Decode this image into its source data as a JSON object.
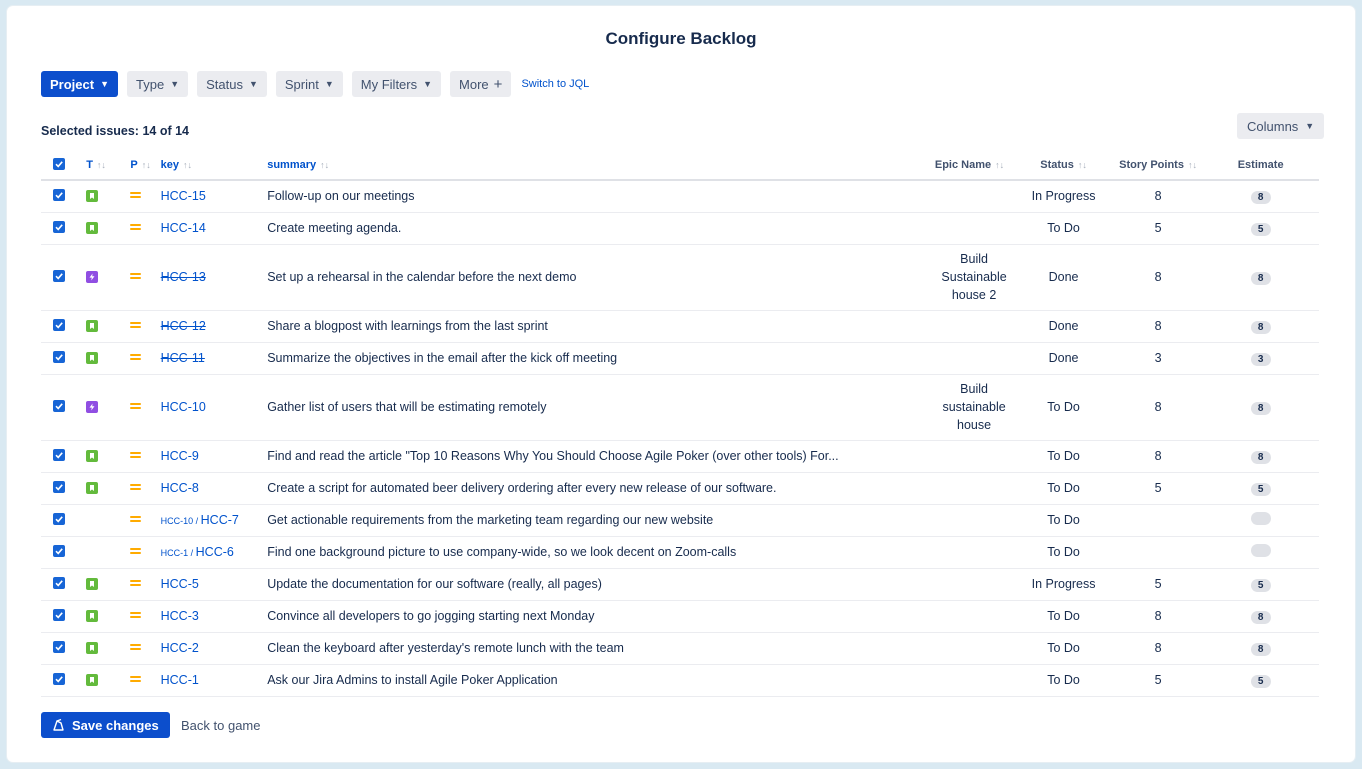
{
  "title": "Configure Backlog",
  "filters": [
    {
      "label": "Project",
      "primary": true,
      "icon": "chevron-down"
    },
    {
      "label": "Type",
      "primary": false,
      "icon": "chevron-down"
    },
    {
      "label": "Status",
      "primary": false,
      "icon": "chevron-down"
    },
    {
      "label": "Sprint",
      "primary": false,
      "icon": "chevron-down"
    },
    {
      "label": "My Filters",
      "primary": false,
      "icon": "chevron-down"
    },
    {
      "label": "More",
      "primary": false,
      "icon": "plus"
    }
  ],
  "switch_jql": "Switch to JQL",
  "selected_text": "Selected issues: 14 of 14",
  "columns_button": "Columns",
  "headers": {
    "t": "T",
    "p": "P",
    "key": "key",
    "summary": "summary",
    "epic": "Epic Name",
    "status": "Status",
    "story_points": "Story Points",
    "estimate": "Estimate"
  },
  "rows": [
    {
      "type": "story",
      "parent": "",
      "key": "HCC-15",
      "done": false,
      "summary": "Follow-up on our meetings",
      "epic": [],
      "status": "In Progress",
      "sp": "8",
      "estimate": "8"
    },
    {
      "type": "story",
      "parent": "",
      "key": "HCC-14",
      "done": false,
      "summary": "Create meeting agenda.",
      "epic": [],
      "status": "To Do",
      "sp": "5",
      "estimate": "5"
    },
    {
      "type": "epic",
      "parent": "",
      "key": "HCC-13",
      "done": true,
      "summary": "Set up a rehearsal in the calendar before the next demo",
      "epic": [
        "Build",
        "Sustainable",
        "house 2"
      ],
      "status": "Done",
      "sp": "8",
      "estimate": "8"
    },
    {
      "type": "story",
      "parent": "",
      "key": "HCC-12",
      "done": true,
      "summary": "Share a blogpost with learnings from the last sprint",
      "epic": [],
      "status": "Done",
      "sp": "8",
      "estimate": "8"
    },
    {
      "type": "story",
      "parent": "",
      "key": "HCC-11",
      "done": true,
      "summary": "Summarize the objectives in the email after the kick off meeting",
      "epic": [],
      "status": "Done",
      "sp": "3",
      "estimate": "3"
    },
    {
      "type": "epic",
      "parent": "",
      "key": "HCC-10",
      "done": false,
      "summary": "Gather list of users that will be estimating remotely",
      "epic": [
        "Build",
        "sustainable",
        "house"
      ],
      "status": "To Do",
      "sp": "8",
      "estimate": "8"
    },
    {
      "type": "story",
      "parent": "",
      "key": "HCC-9",
      "done": false,
      "summary": "Find and read the article \"Top 10 Reasons Why You Should Choose Agile Poker (over other tools) For...",
      "epic": [],
      "status": "To Do",
      "sp": "8",
      "estimate": "8"
    },
    {
      "type": "story",
      "parent": "",
      "key": "HCC-8",
      "done": false,
      "summary": "Create a script for automated beer delivery ordering after every new release of our software.",
      "epic": [],
      "status": "To Do",
      "sp": "5",
      "estimate": "5"
    },
    {
      "type": "subtask",
      "parent": "HCC-10 / ",
      "key": "HCC-7",
      "done": false,
      "summary": "Get actionable requirements from the marketing team regarding our new website",
      "epic": [],
      "status": "To Do",
      "sp": "",
      "estimate": ""
    },
    {
      "type": "subtask",
      "parent": "HCC-1 / ",
      "key": "HCC-6",
      "done": false,
      "summary": "Find one background picture to use company-wide, so we look decent on Zoom-calls",
      "epic": [],
      "status": "To Do",
      "sp": "",
      "estimate": ""
    },
    {
      "type": "story",
      "parent": "",
      "key": "HCC-5",
      "done": false,
      "summary": "Update the documentation for our software (really, all pages)",
      "epic": [],
      "status": "In Progress",
      "sp": "5",
      "estimate": "5"
    },
    {
      "type": "story",
      "parent": "",
      "key": "HCC-3",
      "done": false,
      "summary": "Convince all developers to go jogging starting next Monday",
      "epic": [],
      "status": "To Do",
      "sp": "8",
      "estimate": "8"
    },
    {
      "type": "story",
      "parent": "",
      "key": "HCC-2",
      "done": false,
      "summary": "Clean the keyboard after yesterday's remote lunch with the team",
      "epic": [],
      "status": "To Do",
      "sp": "8",
      "estimate": "8"
    },
    {
      "type": "story",
      "parent": "",
      "key": "HCC-1",
      "done": false,
      "summary": "Ask our Jira Admins to install Agile Poker Application",
      "epic": [],
      "status": "To Do",
      "sp": "5",
      "estimate": "5"
    }
  ],
  "save_button": "Save changes",
  "back_link": "Back to game",
  "colors": {
    "primary": "#0c4ecc",
    "link": "#0052cc",
    "story": "#63ba3c",
    "epic": "#904ee2",
    "subtask": "#4bade8",
    "priority_medium": "#ffab00"
  }
}
